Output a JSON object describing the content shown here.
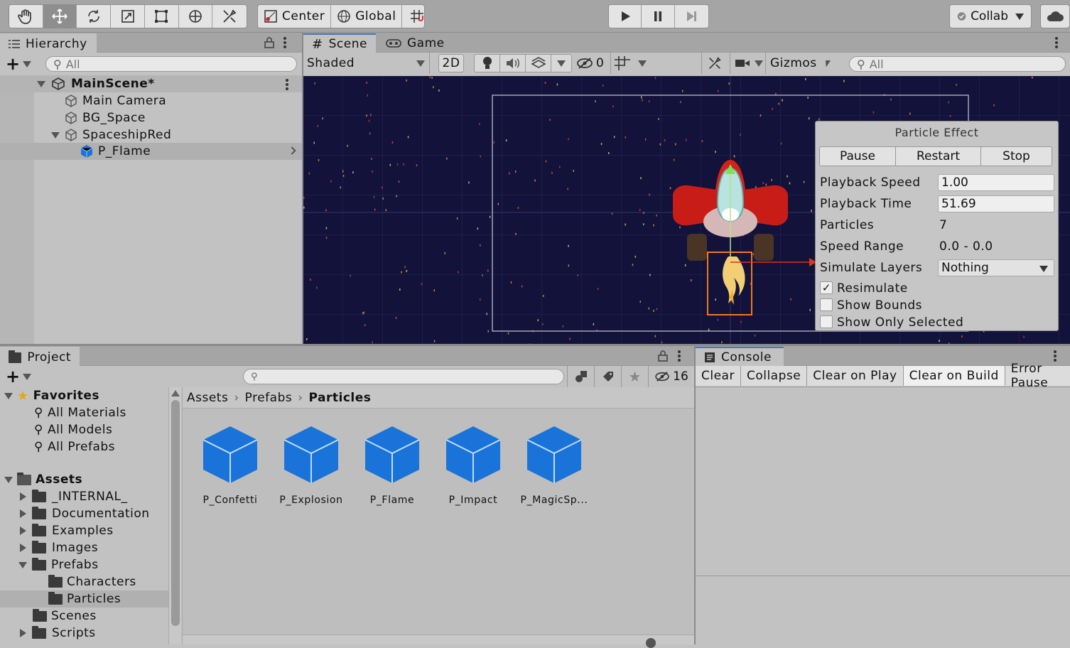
{
  "toolbar": {
    "tools": [
      "hand-tool-icon",
      "move-tool-icon",
      "rotate-tool-icon",
      "scale-tool-icon",
      "rect-tool-icon",
      "transform-tool-icon",
      "custom-tool-icon"
    ],
    "pivot_label": "Center",
    "space_label": "Global",
    "collab_label": "Collab"
  },
  "hierarchy": {
    "tab_label": "Hierarchy",
    "search_placeholder": "All",
    "scene_name": "MainScene*",
    "items": [
      {
        "label": "Main Camera"
      },
      {
        "label": "BG_Space"
      },
      {
        "label": "SpaceshipRed"
      },
      {
        "label": "P_Flame"
      }
    ]
  },
  "scene": {
    "tab_label": "Scene",
    "game_tab_label": "Game",
    "shading_mode": "Shaded",
    "mode_2d": "2D",
    "hidden_count": "0",
    "gizmos_label": "Gizmos",
    "search_placeholder": "All"
  },
  "particle_effect": {
    "title": "Particle Effect",
    "buttons": [
      "Pause",
      "Restart",
      "Stop"
    ],
    "playback_speed_label": "Playback Speed",
    "playback_speed": "1.00",
    "playback_time_label": "Playback Time",
    "playback_time": "51.69",
    "particles_label": "Particles",
    "particles": "7",
    "speed_range_label": "Speed Range",
    "speed_range": "0.0 - 0.0",
    "simulate_layers_label": "Simulate Layers",
    "simulate_layers": "Nothing",
    "resimulate_label": "Resimulate",
    "resimulate": true,
    "show_bounds_label": "Show Bounds",
    "show_bounds": false,
    "show_only_selected_label": "Show Only Selected",
    "show_only_selected": false
  },
  "project": {
    "tab_label": "Project",
    "hidden_count": "16",
    "favorites_label": "Favorites",
    "favorites": [
      "All Materials",
      "All Models",
      "All Prefabs"
    ],
    "assets_label": "Assets",
    "folders": [
      "_INTERNAL_",
      "Documentation",
      "Examples",
      "Images",
      "Prefabs",
      "Characters",
      "Particles",
      "Scenes",
      "Scripts"
    ],
    "breadcrumb": [
      "Assets",
      "Prefabs",
      "Particles"
    ],
    "assets": [
      "P_Confetti",
      "P_Explosion",
      "P_Flame",
      "P_Impact",
      "P_MagicSp..."
    ]
  },
  "console": {
    "tab_label": "Console",
    "buttons": [
      "Clear",
      "Collapse",
      "Clear on Play",
      "Clear on Build",
      "Error Pause"
    ]
  },
  "colors": {
    "accent": "#3a79bb",
    "scene_bg": "#12123a",
    "selection": "#b0b0b0",
    "prefab_blue": "#1a73d9"
  }
}
